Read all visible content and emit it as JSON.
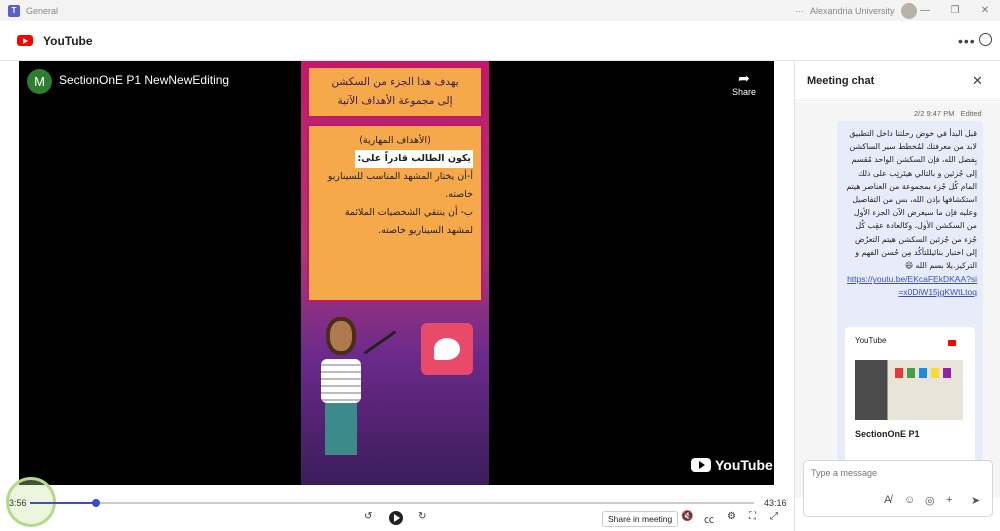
{
  "window": {
    "title": "General",
    "org": "Alexandria University"
  },
  "header": {
    "app_title": "YouTube"
  },
  "video": {
    "channel_initial": "M",
    "title": "SectionOnE P1 NewNewEditing",
    "share_label": "Share",
    "brand": "YouTube",
    "slide": {
      "heading_line1": "يهدف هذا الجزء من السكشن",
      "heading_line2": "إلى مجموعة الأهداف الآتية",
      "subheading": "(الأهداف المهارية)",
      "intro": "يكون الطالب قادراً على:",
      "item1": "أ-أن يختار المشهد المناسب للسيناريو خاصته.",
      "item2": "ب- أن ينتقي الشخصيات الملائمة لمشهد السيناريو خاصته."
    }
  },
  "playback": {
    "current_time": "3:56",
    "total_time": "43:16",
    "progress_fraction": 0.0909,
    "share_in_meeting": "Share in meeting"
  },
  "chat": {
    "title": "Meeting chat",
    "timestamp": "2/2 9:47 PM",
    "edited_label": "Edited",
    "message": "قبل البدأ في خوض رحلتنا داخل التطبيق لابد من معرفتك لمُخطط سير الساكشن بِفضل الله، فإن السكشن الواحد مُقسم إلى جُزئين و بالتالي هيتَرتِب على ذلك المام كُل جُزء بمجموعة من العناصر هيتم استكشافها بإذن الله، بس من التفاصيل وعليه فإن ما سيعرض الآن الجزء الأول من السكشن الأول، وكالعادة عقِب كُل جُزء من جُزئين السكشن هيتم التعرُض إلى اختبار بنائيللتأكُد مِن حُسن الفهم و التركيز.يلا بسم الله 😄",
    "link": "https://youtu.be/EKcaFEkDKAA?si=x0DiW15jgKWtLtoq",
    "card_source": "YouTube",
    "card_title": "SectionOnE P1",
    "compose_placeholder": "Type a message"
  },
  "colors": {
    "accent": "#3b4fc4",
    "youtube_red": "#ff0000",
    "slide_orange": "#f5a94a",
    "slide_magenta": "#c2186b"
  }
}
